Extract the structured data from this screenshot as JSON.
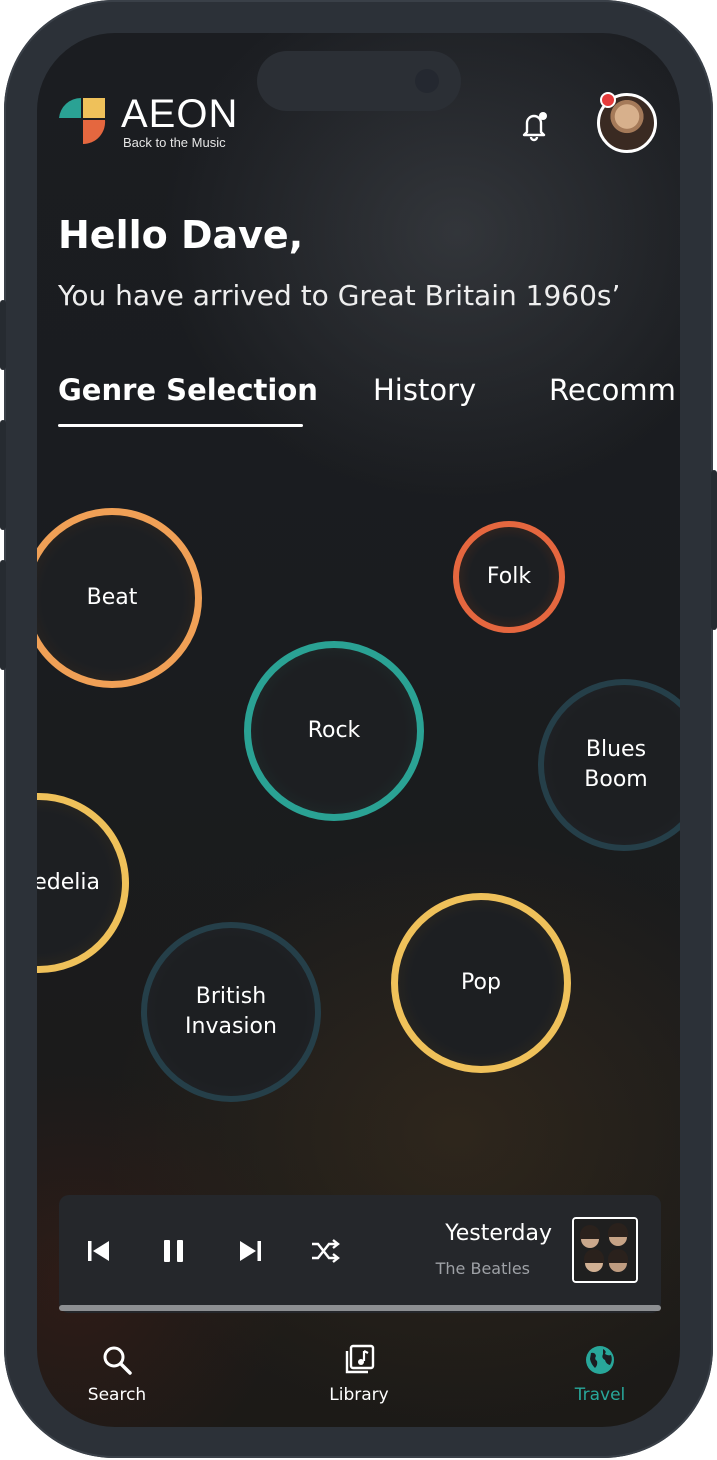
{
  "brand": {
    "name": "AEON",
    "tagline": "Back to the Music"
  },
  "header": {
    "notification_icon": "bell-icon",
    "has_notification": true
  },
  "greeting": {
    "title": "Hello Dave,",
    "subtitle": "You have arrived to Great Britain 1960s’"
  },
  "tabs": [
    {
      "label": "Genre Selection",
      "active": true
    },
    {
      "label": "History",
      "active": false
    },
    {
      "label": "Recommendations",
      "visible_text": "Recomm",
      "active": false
    }
  ],
  "genres": [
    {
      "label": "Beat",
      "color": "#f0a056"
    },
    {
      "label": "Folk",
      "color": "#e5673f"
    },
    {
      "label": "Rock",
      "color": "#2aa294"
    },
    {
      "label": "Blues\nBoom",
      "color": "#253f49"
    },
    {
      "label": "nedelia",
      "color": "#efc15a"
    },
    {
      "label": "British\nInvasion",
      "color": "#253f49"
    },
    {
      "label": "Pop",
      "color": "#efc15a"
    }
  ],
  "player": {
    "song": "Yesterday",
    "artist": "The Beatles",
    "controls": [
      "previous-icon",
      "pause-icon",
      "next-icon",
      "shuffle-icon"
    ],
    "progress": 0.0
  },
  "nav": [
    {
      "label": "Search",
      "icon": "search-icon",
      "active": false
    },
    {
      "label": "Library",
      "icon": "library-icon",
      "active": false
    },
    {
      "label": "Travel",
      "icon": "globe-icon",
      "active": true
    }
  ],
  "colors": {
    "accent": "#28a79a",
    "background": "#1b1d21",
    "frame": "#2c3138"
  }
}
